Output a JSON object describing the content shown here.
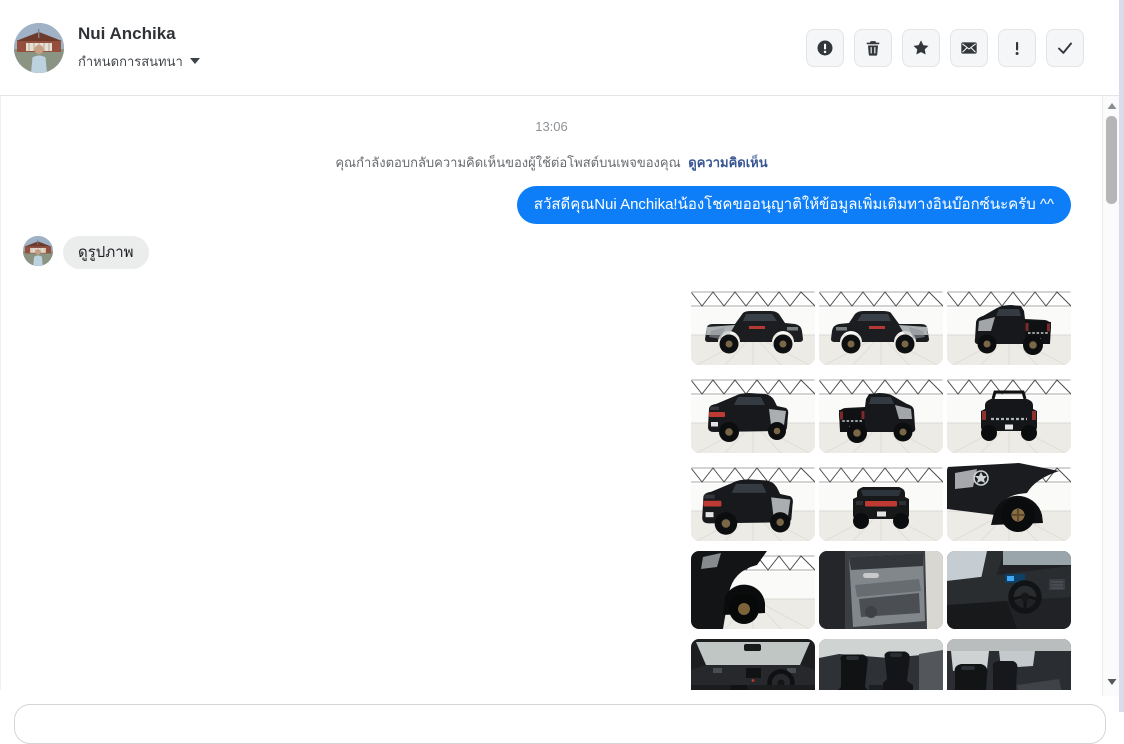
{
  "header": {
    "contact_name": "Nui Anchika",
    "conversation_label": "กำหนดการสนทนา",
    "actions": [
      {
        "label": "report",
        "icon": "exclamation-circle-icon"
      },
      {
        "label": "delete",
        "icon": "trash-icon"
      },
      {
        "label": "star",
        "icon": "star-icon"
      },
      {
        "label": "mark-unread",
        "icon": "envelope-icon"
      },
      {
        "label": "mark-important",
        "icon": "exclamation-icon"
      },
      {
        "label": "mark-done",
        "icon": "check-icon"
      }
    ]
  },
  "conversation": {
    "timestamp": "13:06",
    "system_message": "คุณกำลังตอบกลับความคิดเห็นของผู้ใช้ต่อโพสต์บนเพจของคุณ",
    "system_link_label": "ดูความคิดเห็น",
    "outgoing_message": "สวัสดีคุณNui Anchika!น้องโชคขออนุญาติให้ข้อมูลเพิ่มเติมทางอินบ๊อกซ์นะครับ ^^",
    "incoming_message": "ดูรูปภาพ",
    "photo_grid": {
      "columns": 3,
      "photos": [
        {
          "type": "truck-side-facing-right"
        },
        {
          "type": "truck-side-facing-left"
        },
        {
          "type": "truck-rear-quarter"
        },
        {
          "type": "truck-front-quarter"
        },
        {
          "type": "truck-rear-quarter-left"
        },
        {
          "type": "truck-rear"
        },
        {
          "type": "truck-front-quarter-close"
        },
        {
          "type": "truck-front"
        },
        {
          "type": "truck-wheel-fender"
        },
        {
          "type": "truck-fender-closeup"
        },
        {
          "type": "door-panel"
        },
        {
          "type": "dashboard-steering"
        },
        {
          "type": "dashboard-wide"
        },
        {
          "type": "front-seats"
        },
        {
          "type": "rear-seats"
        }
      ]
    }
  },
  "colors": {
    "outgoing_bubble": "#0d7ef8",
    "incoming_bubble": "#ebecec",
    "system_link": "#3a5795",
    "edge_strip": "#d9dbea"
  }
}
